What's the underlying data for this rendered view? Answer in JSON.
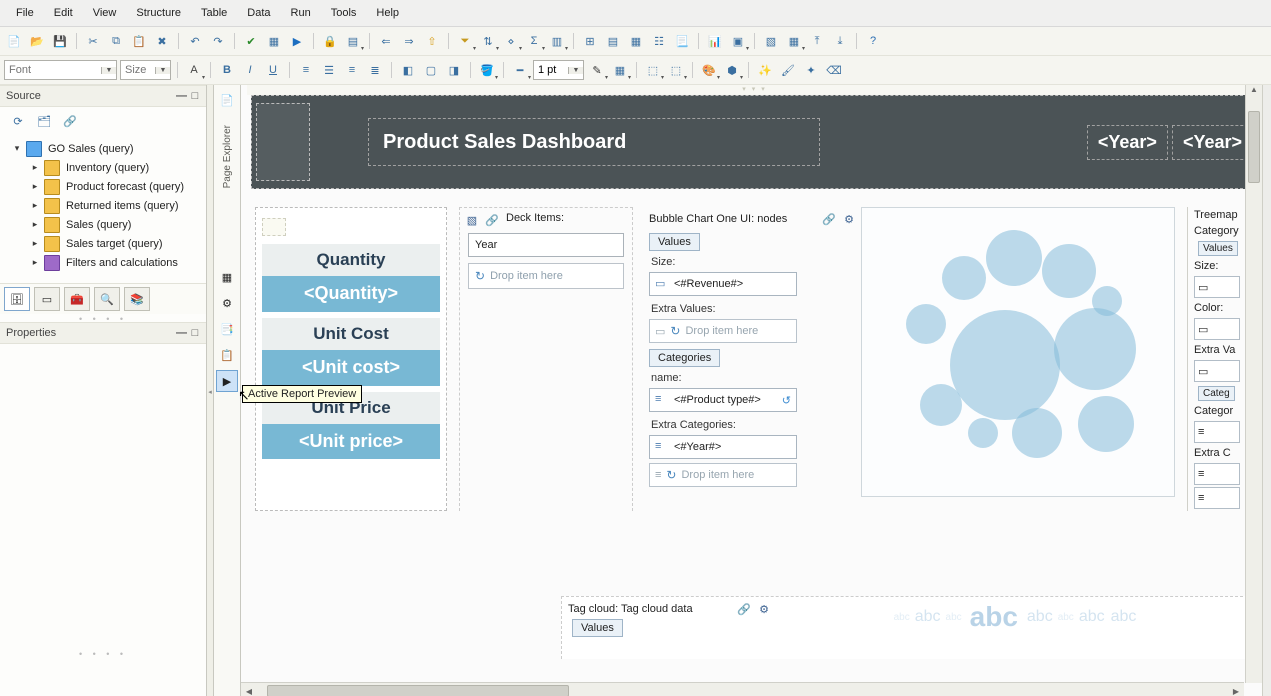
{
  "menu": {
    "file": "File",
    "edit": "Edit",
    "view": "View",
    "structure": "Structure",
    "table": "Table",
    "data": "Data",
    "run": "Run",
    "tools": "Tools",
    "help": "Help"
  },
  "format": {
    "font_placeholder": "Font",
    "size_placeholder": "Size",
    "pt": "1 pt"
  },
  "panels": {
    "source": "Source",
    "properties": "Properties"
  },
  "tree": {
    "root": "GO Sales (query)",
    "items": [
      "Inventory (query)",
      "Product forecast (query)",
      "Returned items (query)",
      "Sales (query)",
      "Sales target (query)",
      "Filters and calculations"
    ]
  },
  "pagestrip": {
    "label": "Page Explorer",
    "tooltip": "Active Report Preview"
  },
  "header": {
    "title": "Product Sales Dashboard",
    "year": "<Year>"
  },
  "cards": {
    "q_hdr": "Quantity",
    "q_val": "<Quantity>",
    "uc_hdr": "Unit Cost",
    "uc_val": "<Unit cost>",
    "up_hdr": "Unit Price",
    "up_val": "<Unit price>"
  },
  "deck": {
    "title": "Deck Items:",
    "year": "Year",
    "drop": "Drop item here"
  },
  "bubble": {
    "title": "Bubble Chart One UI: nodes",
    "values_btn": "Values",
    "size_lbl": "Size:",
    "revenue": "<#Revenue#>",
    "extra_values": "Extra Values:",
    "drop": "Drop item here",
    "categories_btn": "Categories",
    "name_lbl": "name:",
    "ptype": "<#Product type#>",
    "extra_cat": "Extra Categories:",
    "year_chip": "<#Year#>"
  },
  "treemap": {
    "title": "Treemap",
    "cat": "Category",
    "values_btn": "Values",
    "size_lbl": "Size:",
    "color_lbl": "Color:",
    "extra_v": "Extra Va",
    "cat_btn": "Categ",
    "cat_lbl": "Categor",
    "extra_c": "Extra C"
  },
  "tagcloud": {
    "title": "Tag cloud: Tag cloud data",
    "values_btn": "Values",
    "abc": "abc"
  }
}
